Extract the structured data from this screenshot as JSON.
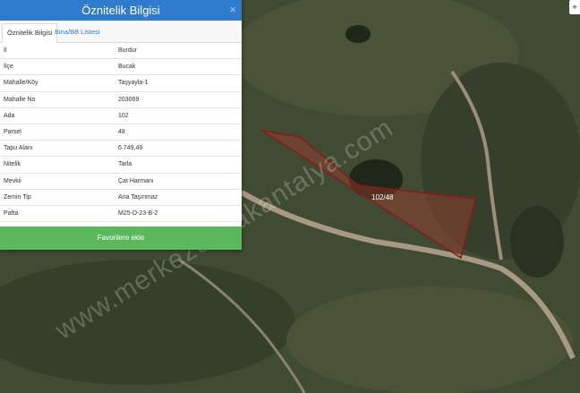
{
  "panel": {
    "title": "Öznitelik Bilgisi",
    "close_icon": "×",
    "tabs": [
      {
        "label": "Öznitelik Bilgisi",
        "active": true
      },
      {
        "label": "Bina/BB Listesi",
        "active": false
      }
    ],
    "rows": [
      {
        "key": "İl",
        "value": "Burdur"
      },
      {
        "key": "İlçe",
        "value": "Bucak"
      },
      {
        "key": "Mahalle/Köy",
        "value": "Taşyayla-1"
      },
      {
        "key": "Mahalle No",
        "value": "203069"
      },
      {
        "key": "Ada",
        "value": "102"
      },
      {
        "key": "Parsel",
        "value": "48"
      },
      {
        "key": "Tapu Alanı",
        "value": "6.749,49"
      },
      {
        "key": "Nitelik",
        "value": "Tarla"
      },
      {
        "key": "Mevkii",
        "value": "Çat Harmanı"
      },
      {
        "key": "Zemin Tip",
        "value": "Ana Taşınmaz"
      },
      {
        "key": "Pafta",
        "value": "M25-D-23-B-2"
      }
    ],
    "favorite_button": "Favorilere ekle"
  },
  "map": {
    "parcel_label": "102/48",
    "watermark": "www.merkezemlakantalya.com",
    "control_icon": "crosshair-icon",
    "colors": {
      "header": "#2f7ccf",
      "button": "#5cb85c",
      "parcel_stroke": "#8b1a1a",
      "parcel_fill": "rgba(190,60,50,0.35)"
    }
  }
}
